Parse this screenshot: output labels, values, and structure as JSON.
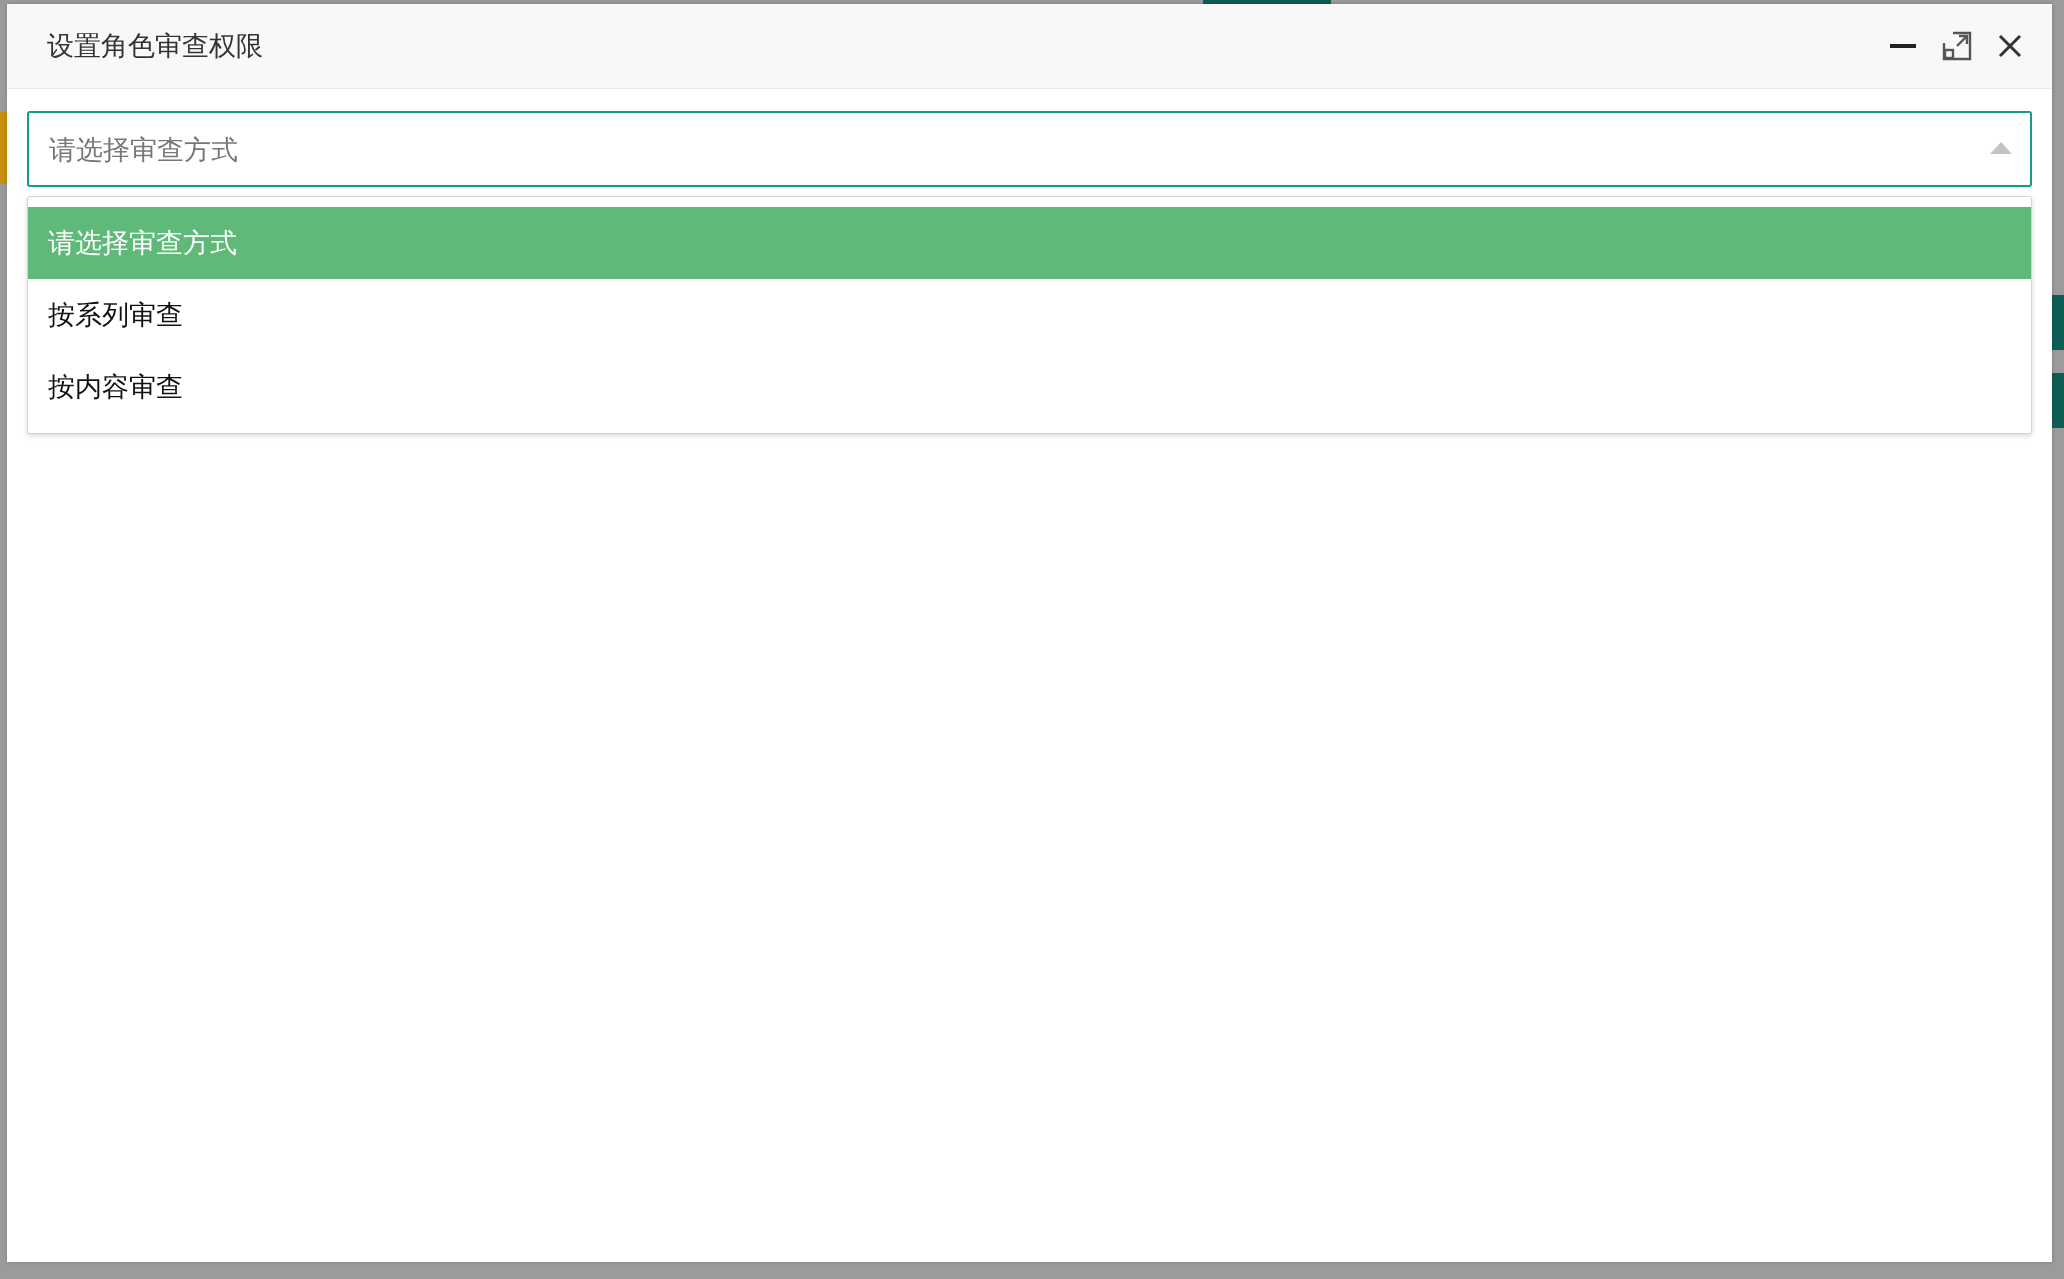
{
  "dialog": {
    "title": "设置角色审查权限"
  },
  "select": {
    "placeholder": "请选择审查方式",
    "expanded": true
  },
  "options": [
    {
      "label": "请选择审查方式",
      "selected": true
    },
    {
      "label": "按系列审查",
      "selected": false
    },
    {
      "label": "按内容审查",
      "selected": false
    }
  ]
}
